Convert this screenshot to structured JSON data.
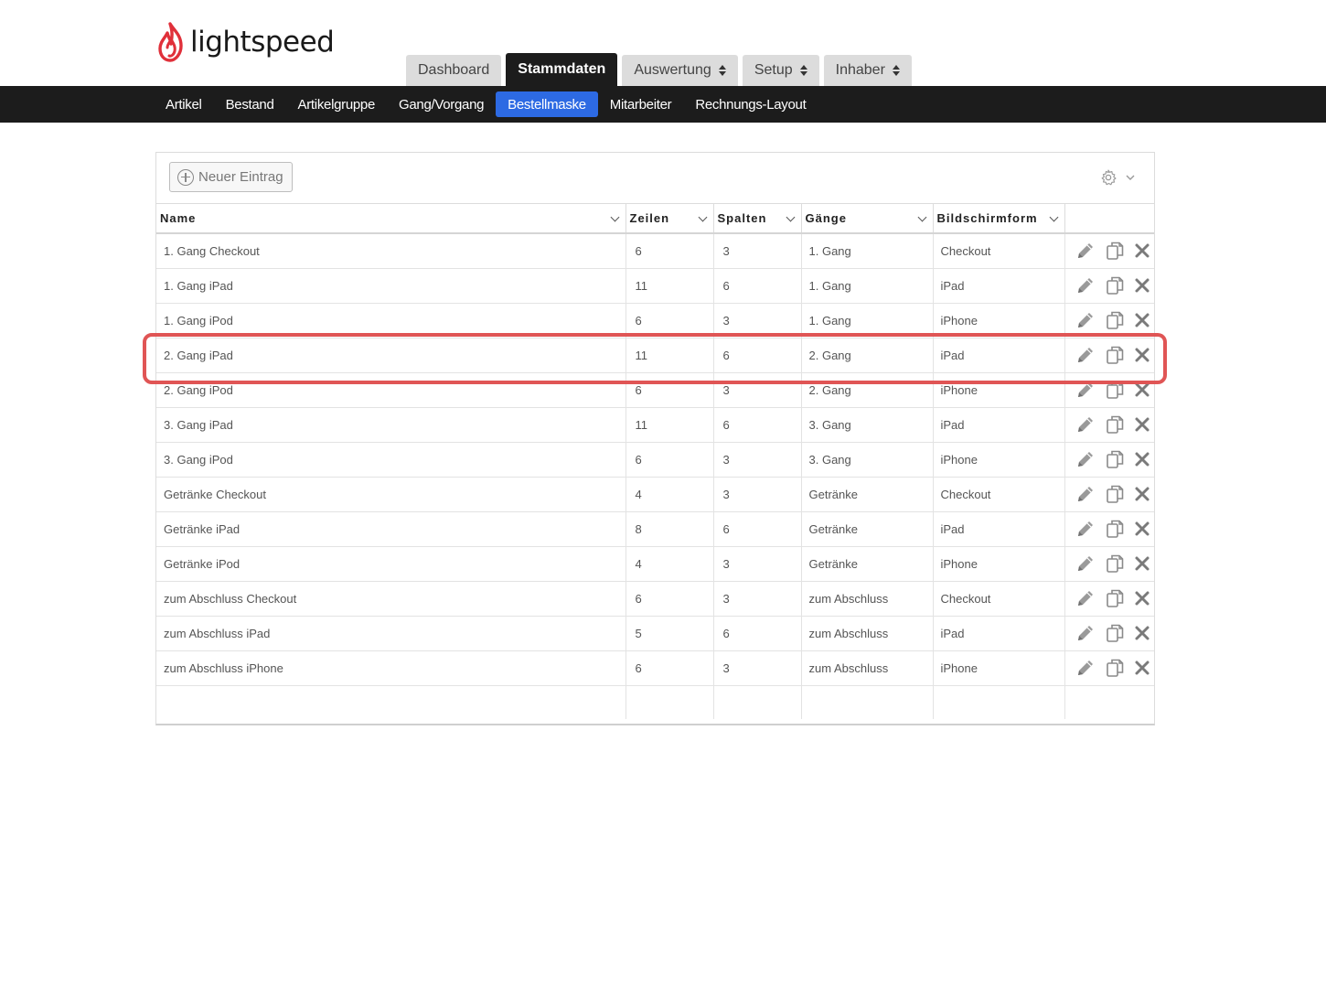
{
  "brand": {
    "name": "lightspeed",
    "accent": "#e0303a"
  },
  "top_tabs": [
    {
      "label": "Dashboard",
      "active": false,
      "dropdown": false
    },
    {
      "label": "Stammdaten",
      "active": true,
      "dropdown": false
    },
    {
      "label": "Auswertung",
      "active": false,
      "dropdown": true
    },
    {
      "label": "Setup",
      "active": false,
      "dropdown": true
    },
    {
      "label": "Inhaber",
      "active": false,
      "dropdown": true
    }
  ],
  "sub_nav": [
    {
      "label": "Artikel",
      "active": false
    },
    {
      "label": "Bestand",
      "active": false
    },
    {
      "label": "Artikelgruppe",
      "active": false
    },
    {
      "label": "Gang/Vorgang",
      "active": false
    },
    {
      "label": "Bestellmaske",
      "active": true
    },
    {
      "label": "Mitarbeiter",
      "active": false
    },
    {
      "label": "Rechnungs-Layout",
      "active": false
    }
  ],
  "toolbar": {
    "new_entry_label": "Neuer Eintrag",
    "settings_icon": "gear-icon"
  },
  "table": {
    "columns": [
      "Name",
      "Zeilen",
      "Spalten",
      "Gänge",
      "Bildschirmform"
    ],
    "rows": [
      [
        "1. Gang Checkout",
        "6",
        "3",
        "1. Gang",
        "Checkout"
      ],
      [
        "1. Gang iPad",
        "11",
        "6",
        "1. Gang",
        "iPad"
      ],
      [
        "1. Gang iPod",
        "6",
        "3",
        "1. Gang",
        "iPhone"
      ],
      [
        "2. Gang iPad",
        "11",
        "6",
        "2. Gang",
        "iPad"
      ],
      [
        "2. Gang iPod",
        "6",
        "3",
        "2. Gang",
        "iPhone"
      ],
      [
        "3. Gang iPad",
        "11",
        "6",
        "3. Gang",
        "iPad"
      ],
      [
        "3. Gang iPod",
        "6",
        "3",
        "3. Gang",
        "iPhone"
      ],
      [
        "Getränke Checkout",
        "4",
        "3",
        "Getränke",
        "Checkout"
      ],
      [
        "Getränke iPad",
        "8",
        "6",
        "Getränke",
        "iPad"
      ],
      [
        "Getränke iPod",
        "4",
        "3",
        "Getränke",
        "iPhone"
      ],
      [
        "zum Abschluss Checkout",
        "6",
        "3",
        "zum Abschluss",
        "Checkout"
      ],
      [
        "zum Abschluss iPad",
        "5",
        "6",
        "zum Abschluss",
        "iPad"
      ],
      [
        "zum Abschluss iPhone",
        "6",
        "3",
        "zum Abschluss",
        "iPhone"
      ]
    ],
    "row_actions": [
      "pencil-icon",
      "copy-icon",
      "close-icon"
    ],
    "highlighted_row": 3
  },
  "colors": {
    "nav_bg": "#1c1c1c",
    "active_sub": "#2d6ae3",
    "highlight": "#e05555"
  }
}
